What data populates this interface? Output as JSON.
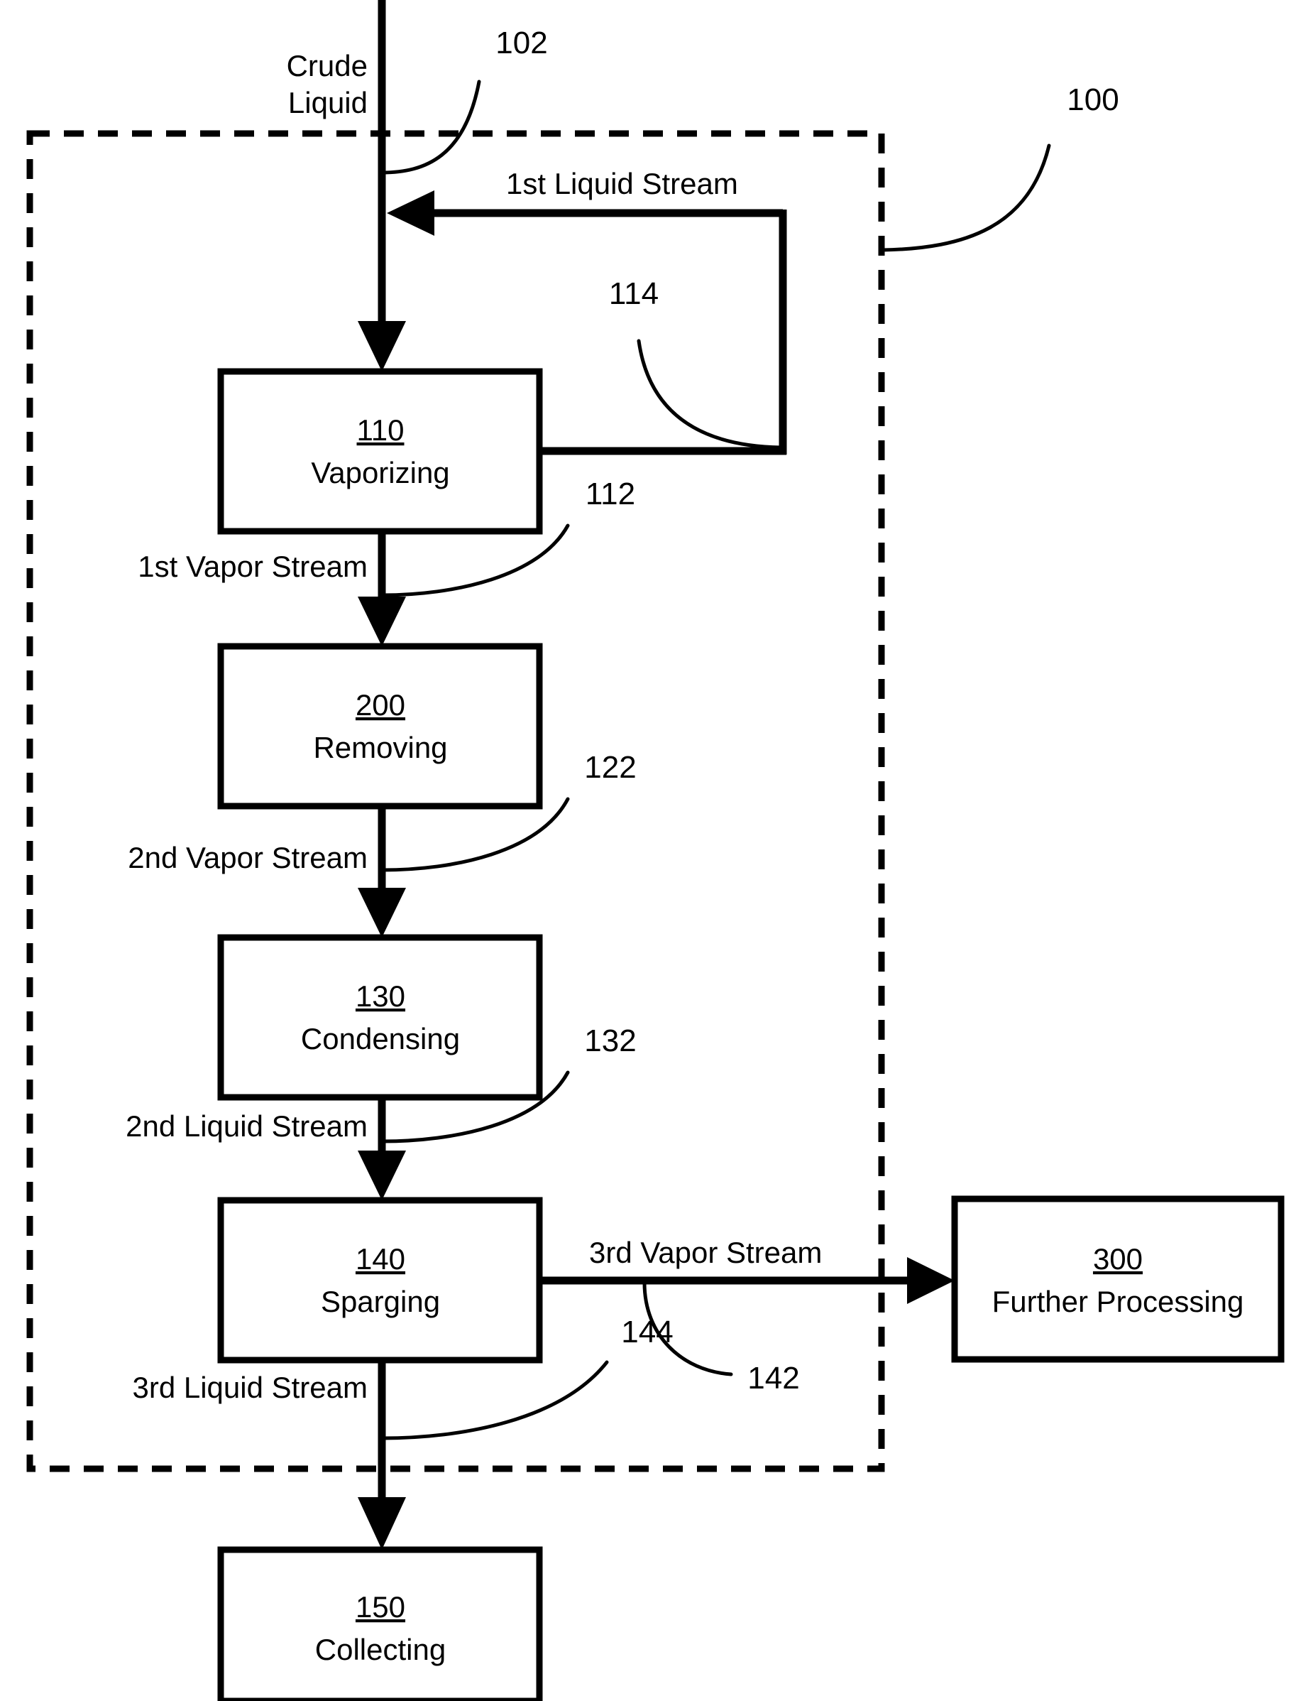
{
  "figure": {
    "type": "patent-process-flow-diagram",
    "title": "",
    "system_reference": "100"
  },
  "boxes": [
    {
      "ref": "110",
      "title": "Vaporizing"
    },
    {
      "ref": "200",
      "title": "Removing"
    },
    {
      "ref": "130",
      "title": "Condensing"
    },
    {
      "ref": "140",
      "title": "Sparging"
    },
    {
      "ref": "150",
      "title": "Collecting"
    },
    {
      "ref": "300",
      "title": "Further Processing"
    }
  ],
  "streams": [
    {
      "label": "Crude Liquid",
      "ref": "102"
    },
    {
      "label": "1st Liquid Stream",
      "ref": "114"
    },
    {
      "label": "1st Vapor Stream",
      "ref": "112"
    },
    {
      "label": "2nd Vapor Stream",
      "ref": "122"
    },
    {
      "label": "2nd Liquid Stream",
      "ref": "132"
    },
    {
      "label": "3rd Vapor Stream",
      "ref": "142"
    },
    {
      "label": "3rd Liquid Stream",
      "ref": "144"
    }
  ],
  "labels": {
    "crude_liquid_line1": "Crude",
    "crude_liquid_line2": "Liquid",
    "first_liquid_stream": "1st Liquid Stream",
    "first_vapor_stream": "1st Vapor Stream",
    "second_vapor_stream": "2nd Vapor Stream",
    "second_liquid_stream": "2nd Liquid Stream",
    "third_vapor_stream": "3rd Vapor Stream",
    "third_liquid_stream": "3rd Liquid Stream"
  },
  "refs": {
    "system": "100",
    "crude_feed": "102",
    "first_vapor": "112",
    "first_liquid_recycle": "114",
    "second_vapor": "122",
    "second_liquid": "132",
    "third_vapor": "142",
    "third_liquid": "144"
  },
  "box_labels": {
    "vaporizing_ref": "110",
    "vaporizing_title": "Vaporizing",
    "removing_ref": "200",
    "removing_title": "Removing",
    "condensing_ref": "130",
    "condensing_title": "Condensing",
    "sparging_ref": "140",
    "sparging_title": "Sparging",
    "collecting_ref": "150",
    "collecting_title": "Collecting",
    "further_ref": "300",
    "further_title": "Further Processing"
  },
  "colors": {
    "line": "#000000",
    "background": "#ffffff",
    "box_fill": "#ffffff"
  }
}
